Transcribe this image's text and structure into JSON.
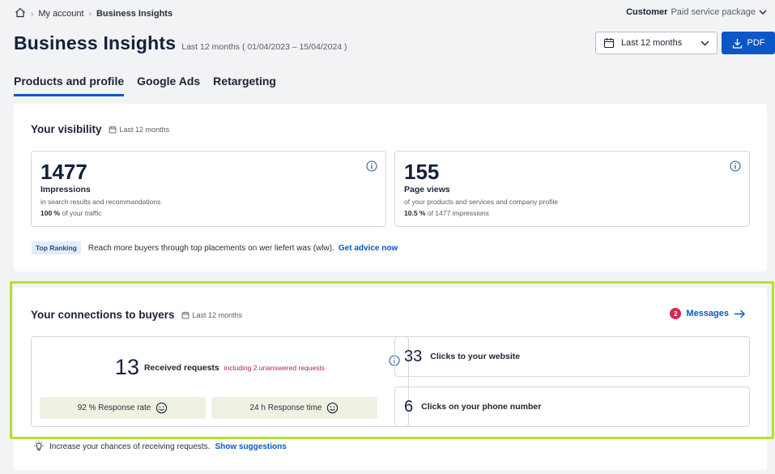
{
  "breadcrumb": {
    "home_icon": "home-icon",
    "items": [
      "My account",
      "Business Insights"
    ]
  },
  "account": {
    "role": "Customer",
    "package": "Paid service package"
  },
  "header": {
    "title": "Business Insights",
    "range": "Last 12 months ( 01/04/2023 – 15/04/2024 )",
    "period_select": "Last 12 months",
    "pdf_label": "PDF"
  },
  "tabs": [
    "Products and profile",
    "Google Ads",
    "Retargeting"
  ],
  "visibility": {
    "title": "Your visibility",
    "period": "Last 12 months",
    "impressions": {
      "value": "1477",
      "label": "Impressions",
      "desc": "in search results and recommandations",
      "pct": "100 %",
      "pct_rest": "of your traffic"
    },
    "page_views": {
      "value": "155",
      "label": "Page views",
      "desc": "of your products and services and company profile",
      "pct": "10.5 %",
      "pct_rest": "of 1477 impressions"
    },
    "ranking": {
      "badge": "Top Ranking",
      "text": "Reach more buyers through top placements on  wer liefert was (wlw).",
      "link": "Get advice now"
    }
  },
  "connections": {
    "title": "Your connections to buyers",
    "period": "Last 12 months",
    "messages": {
      "count": "2",
      "label": "Messages"
    },
    "requests": {
      "value": "13",
      "label": "Received requests",
      "unanswered": "including 2 unanswered requests",
      "response_rate": "92 % Response rate",
      "response_time": "24 h Response time"
    },
    "website_clicks": {
      "value": "33",
      "label": "Clicks to your website"
    },
    "phone_clicks": {
      "value": "6",
      "label": "Clicks on your phone number"
    },
    "suggestion": {
      "text": "Increase your chances of receiving requests.",
      "link": "Show suggestions"
    }
  },
  "colors": {
    "accent": "#0a57c8",
    "highlight": "#b6e12c",
    "alert": "#d42a55"
  }
}
